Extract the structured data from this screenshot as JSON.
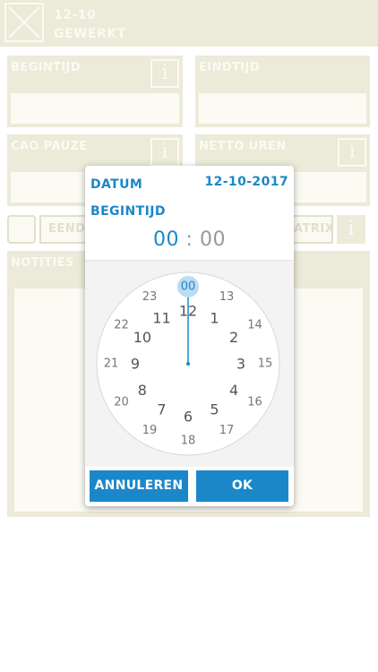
{
  "header": {
    "line1": "12-10",
    "line2": "GEWERKT"
  },
  "fields": {
    "begintijd": "BEGINTIJD",
    "eindtijd": "EINDTIJD",
    "cao_pauze": "CAO PAUZE",
    "netto_uren": "NETTO UREN",
    "notities": "NOTITIES",
    "info_glyph": "i"
  },
  "pills": {
    "left": "EENDA",
    "right": "ATRIX"
  },
  "dialog": {
    "date_label": "DATUM",
    "date_value": "12-10-2017",
    "time_label": "BEGINTIJD",
    "hours": "00",
    "separator": ":",
    "minutes": "00",
    "cancel_label": "ANNULEREN",
    "ok_label": "OK"
  },
  "clock": {
    "selected_hour": "00",
    "inner_hours": [
      "12",
      "1",
      "2",
      "3",
      "4",
      "5",
      "6",
      "7",
      "8",
      "9",
      "10",
      "11"
    ],
    "outer_hours": [
      "00",
      "13",
      "14",
      "15",
      "16",
      "17",
      "18",
      "19",
      "20",
      "21",
      "22",
      "23"
    ]
  },
  "colors": {
    "accent": "#1b87c9",
    "background_panel": "#ecead8"
  }
}
